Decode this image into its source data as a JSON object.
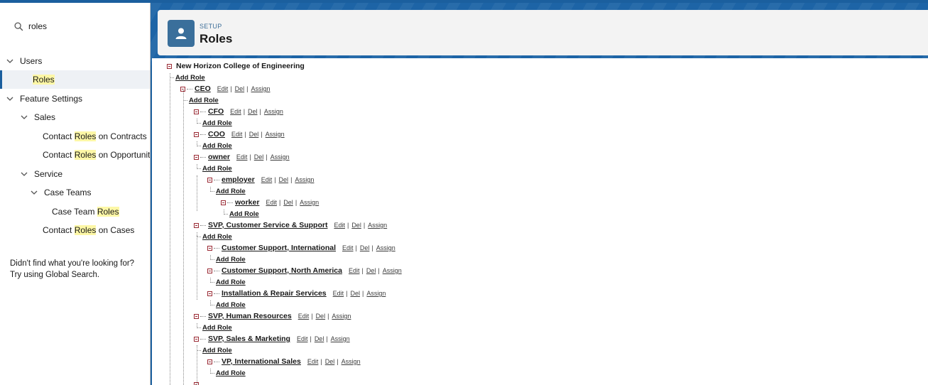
{
  "sidebar": {
    "search": {
      "value": "roles"
    },
    "items": [
      {
        "pre": "Users",
        "hl": "",
        "post": "",
        "chevron": true
      },
      {
        "pre": "",
        "hl": "Roles",
        "post": "",
        "chevron": false
      },
      {
        "pre": "Feature Settings",
        "hl": "",
        "post": "",
        "chevron": true
      },
      {
        "pre": "Sales",
        "hl": "",
        "post": "",
        "chevron": true
      },
      {
        "pre": "Contact ",
        "hl": "Roles",
        "post": " on Contracts",
        "chevron": false
      },
      {
        "pre": "Contact ",
        "hl": "Roles",
        "post": " on Opportunities",
        "chevron": false
      },
      {
        "pre": "Service",
        "hl": "",
        "post": "",
        "chevron": true
      },
      {
        "pre": "Case Teams",
        "hl": "",
        "post": "",
        "chevron": true
      },
      {
        "pre": "Case Team ",
        "hl": "Roles",
        "post": "",
        "chevron": false
      },
      {
        "pre": "Contact ",
        "hl": "Roles",
        "post": " on Cases",
        "chevron": false
      }
    ],
    "help_line1": "Didn't find what you're looking for?",
    "help_line2": "Try using Global Search."
  },
  "header": {
    "setup_label": "SETUP",
    "title": "Roles",
    "icon": "user-icon"
  },
  "roles": {
    "root": "New Horizon College of Engineering",
    "add_role_label": "Add Role",
    "edit_label": "Edit",
    "del_label": "Del",
    "assign_label": "Assign",
    "separator": "|",
    "nodes": [
      {
        "name": "CEO",
        "depth": 1
      },
      {
        "name": "CFO",
        "depth": 2
      },
      {
        "name": "COO",
        "depth": 2
      },
      {
        "name": "owner",
        "depth": 2
      },
      {
        "name": "employer",
        "depth": 3
      },
      {
        "name": "worker",
        "depth": 4
      },
      {
        "name": "SVP, Customer Service & Support",
        "depth": 2
      },
      {
        "name": "Customer Support, International",
        "depth": 3
      },
      {
        "name": "Customer Support, North America",
        "depth": 3
      },
      {
        "name": "Installation & Repair Services",
        "depth": 3
      },
      {
        "name": "SVP, Human Resources",
        "depth": 2
      },
      {
        "name": "SVP, Sales & Marketing",
        "depth": 2
      },
      {
        "name": "VP, International Sales",
        "depth": 3
      }
    ]
  }
}
